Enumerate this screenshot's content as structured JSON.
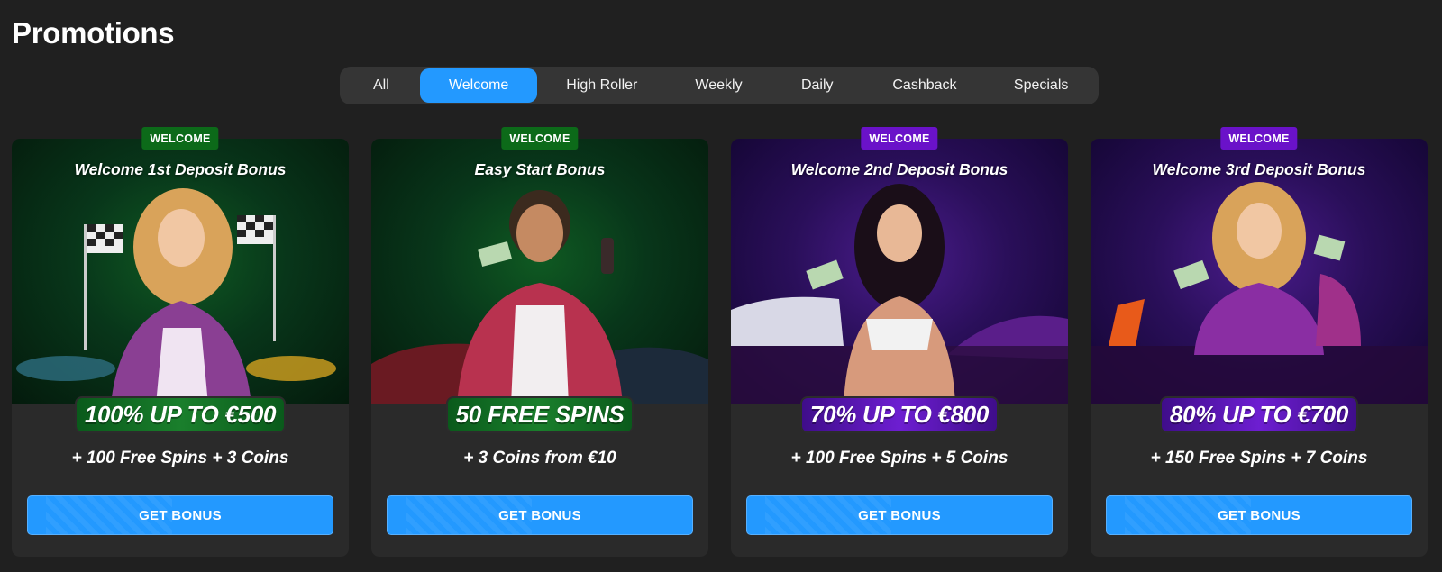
{
  "page": {
    "title": "Promotions"
  },
  "tabs": [
    {
      "label": "All",
      "active": false
    },
    {
      "label": "Welcome",
      "active": true
    },
    {
      "label": "High Roller",
      "active": false
    },
    {
      "label": "Weekly",
      "active": false
    },
    {
      "label": "Daily",
      "active": false
    },
    {
      "label": "Cashback",
      "active": false
    },
    {
      "label": "Specials",
      "active": false
    }
  ],
  "colors": {
    "background": "#202020",
    "accent": "#2399ff",
    "badge_green": "#0c6a19",
    "badge_purple": "#6a12c9"
  },
  "cards": [
    {
      "badge": "WELCOME",
      "theme": "green",
      "title": "Welcome 1st Deposit Bonus",
      "amount": "100% UP TO €500",
      "extra": "+ 100 Free Spins + 3 Coins",
      "cta": "GET BONUS"
    },
    {
      "badge": "WELCOME",
      "theme": "green",
      "title": "Easy Start Bonus",
      "amount": "50 FREE SPINS",
      "extra": "+ 3 Coins from €10",
      "cta": "GET BONUS"
    },
    {
      "badge": "WELCOME",
      "theme": "purple",
      "title": "Welcome 2nd Deposit Bonus",
      "amount": "70% UP TO €800",
      "extra": "+ 100 Free Spins + 5 Coins",
      "cta": "GET BONUS"
    },
    {
      "badge": "WELCOME",
      "theme": "purple",
      "title": "Welcome 3rd Deposit Bonus",
      "amount": "80% UP TO €700",
      "extra": "+ 150 Free Spins + 7 Coins",
      "cta": "GET BONUS"
    }
  ]
}
